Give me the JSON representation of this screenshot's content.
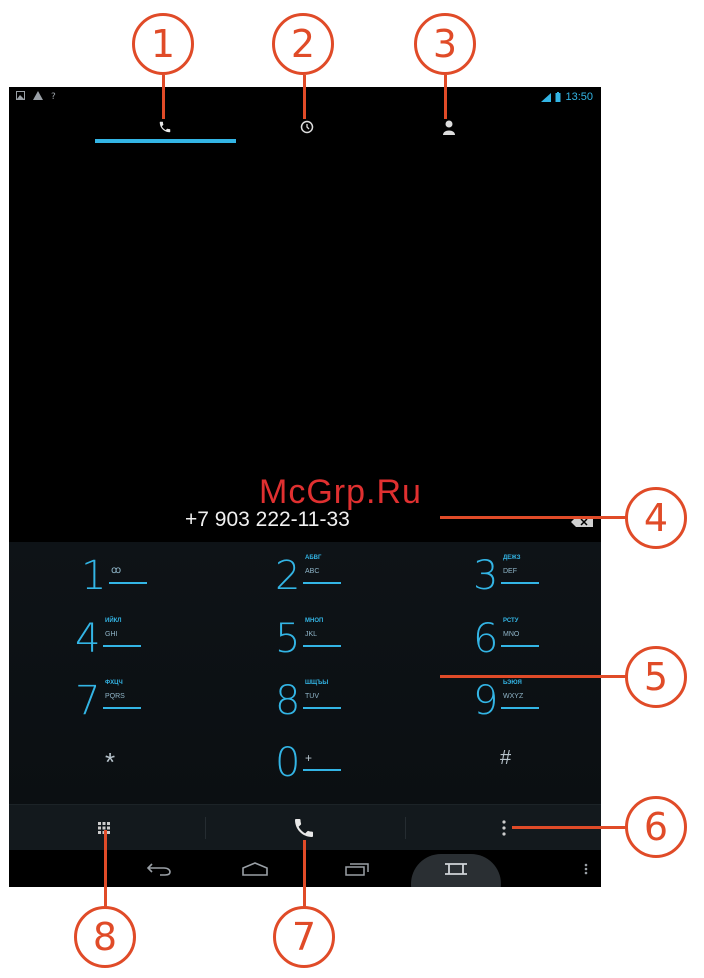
{
  "callouts": [
    "1",
    "2",
    "3",
    "4",
    "5",
    "6",
    "7",
    "8"
  ],
  "watermark": "McGrp.Ru",
  "status_bar": {
    "left_icons": [
      "image-icon",
      "warning-icon",
      "question-icon"
    ],
    "time": "13:50",
    "accent": "#33b5e5"
  },
  "tabs": [
    {
      "name": "phone-tab-icon",
      "selected": true
    },
    {
      "name": "recent-tab-icon",
      "selected": false
    },
    {
      "name": "contacts-tab-icon",
      "selected": false
    }
  ],
  "dialer": {
    "number": "+7 903 222-11-33"
  },
  "keys": [
    {
      "digit": "1",
      "cyr": "",
      "lat": "ꝏ"
    },
    {
      "digit": "2",
      "cyr": "АБВГ",
      "lat": "ABC"
    },
    {
      "digit": "3",
      "cyr": "ДЕЖЗ",
      "lat": "DEF"
    },
    {
      "digit": "4",
      "cyr": "ИЙКЛ",
      "lat": "GHI"
    },
    {
      "digit": "5",
      "cyr": "МНОП",
      "lat": "JKL"
    },
    {
      "digit": "6",
      "cyr": "РСТУ",
      "lat": "MNO"
    },
    {
      "digit": "7",
      "cyr": "ФХЦЧ",
      "lat": "PQRS"
    },
    {
      "digit": "8",
      "cyr": "ШЩЪЫ",
      "lat": "TUV"
    },
    {
      "digit": "9",
      "cyr": "ЬЭЮЯ",
      "lat": "WXYZ"
    }
  ],
  "bottom_keys": {
    "star": "*",
    "zero": "0",
    "zero_sub": "+",
    "hash": "#"
  },
  "colors": {
    "accent": "#33b5e5",
    "callout": "#e04b28",
    "background": "#000000"
  }
}
